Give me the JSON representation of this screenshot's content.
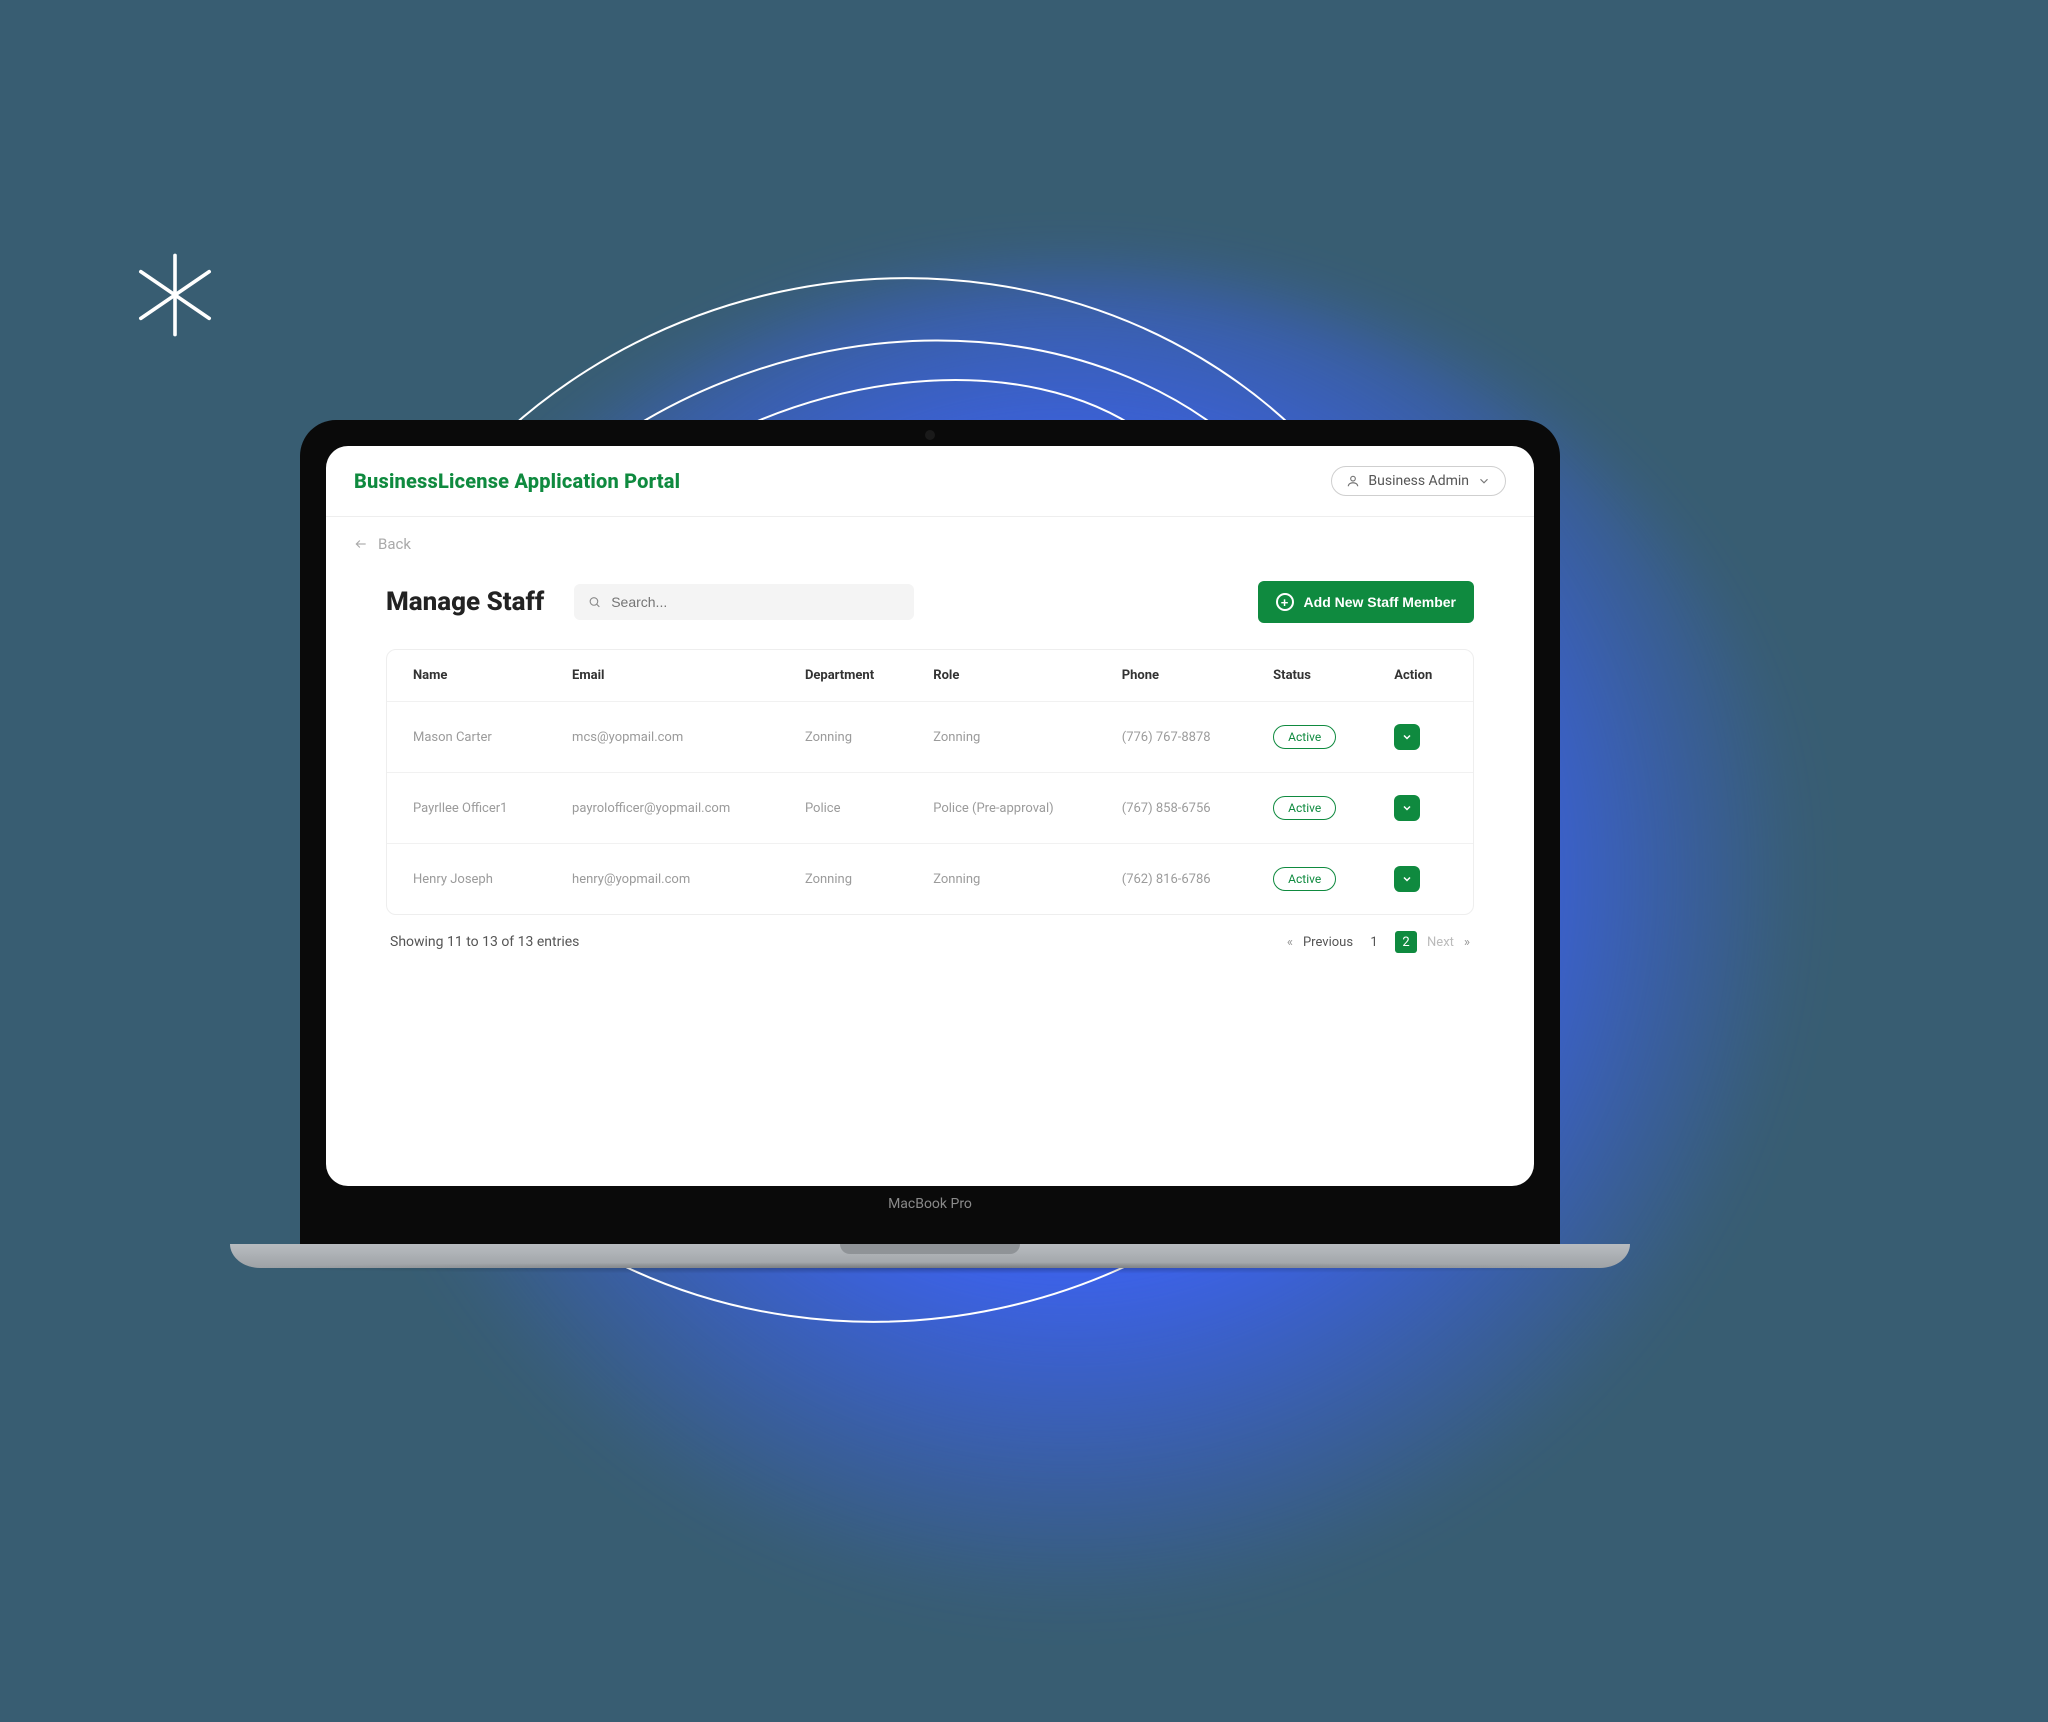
{
  "device_label": "MacBook Pro",
  "header": {
    "brand": "BusinessLicense Application Portal",
    "user_label": "Business Admin"
  },
  "back_label": "Back",
  "page": {
    "title": "Manage Staff",
    "search_placeholder": "Search...",
    "add_button": "Add New Staff Member"
  },
  "table": {
    "columns": {
      "name": "Name",
      "email": "Email",
      "department": "Department",
      "role": "Role",
      "phone": "Phone",
      "status": "Status",
      "action": "Action"
    },
    "rows": [
      {
        "name": "Mason Carter",
        "email": "mcs@yopmail.com",
        "department": "Zonning",
        "role": "Zonning",
        "phone": "(776) 767-8878",
        "status": "Active"
      },
      {
        "name": "Payrllee Officer1",
        "email": "payrolofficer@yopmail.com",
        "department": "Police",
        "role": "Police (Pre-approval)",
        "phone": "(767) 858-6756",
        "status": "Active"
      },
      {
        "name": "Henry Joseph",
        "email": "henry@yopmail.com",
        "department": "Zonning",
        "role": "Zonning",
        "phone": "(762) 816-6786",
        "status": "Active"
      }
    ]
  },
  "footer": {
    "summary": "Showing 11 to 13 of 13 entries",
    "prev": "Previous",
    "next": "Next",
    "page1": "1",
    "page2": "2"
  },
  "colors": {
    "accent": "#0f8a3f",
    "bg": "#385d72",
    "glow": "#3d63ff"
  }
}
